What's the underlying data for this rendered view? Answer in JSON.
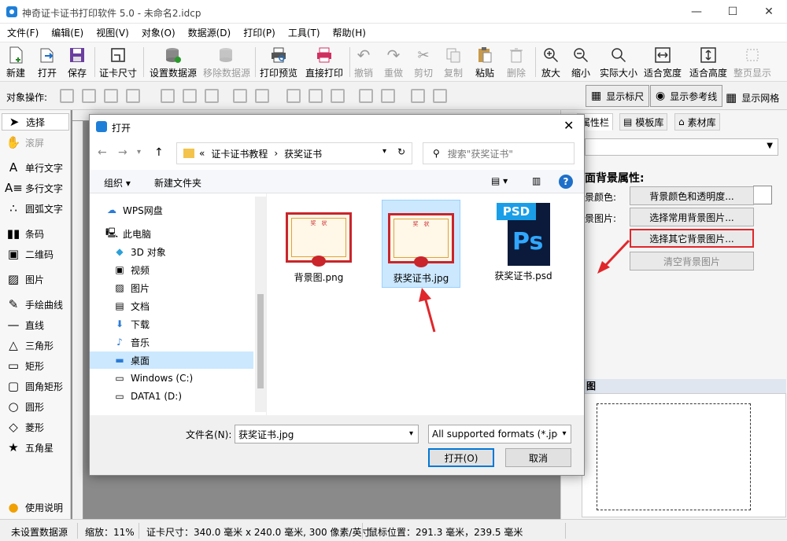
{
  "window": {
    "title": "神奇证卡证书打印软件 5.0 - 未命名2.idcp"
  },
  "menu": [
    "文件(F)",
    "编辑(E)",
    "视图(V)",
    "对象(O)",
    "数据源(D)",
    "打印(P)",
    "工具(T)",
    "帮助(H)"
  ],
  "toolbar": {
    "new": "新建",
    "open": "打开",
    "save": "保存",
    "card_size": "证卡尺寸",
    "set_datasource": "设置数据源",
    "remove_datasource": "移除数据源",
    "print_preview": "打印预览",
    "direct_print": "直接打印",
    "undo": "撤销",
    "redo": "重做",
    "cut": "剪切",
    "copy": "复制",
    "paste": "粘贴",
    "delete": "删除",
    "zoom_in": "放大",
    "zoom_out": "缩小",
    "actual_size": "实际大小",
    "fit_width": "适合宽度",
    "fit_height": "适合高度",
    "full_page": "整页显示"
  },
  "ops": {
    "label": "对象操作:",
    "show_ruler": "显示标尺",
    "show_guides": "显示参考线",
    "show_grid": "显示网格"
  },
  "tools": [
    "选择",
    "滚屏",
    "单行文字",
    "多行文字",
    "圆弧文字",
    "条码",
    "二维码",
    "图片",
    "手绘曲线",
    "直线",
    "三角形",
    "矩形",
    "圆角矩形",
    "圆形",
    "菱形",
    "五角星",
    "使用说明"
  ],
  "right_panel": {
    "tabs": [
      "属性栏",
      "模板库",
      "素材库"
    ],
    "section_title": "面背景属性:",
    "bg_color_label": "景颜色:",
    "bg_image_label": "景图片:",
    "btn_color": "背景颜色和透明度...",
    "btn_common_bg": "选择常用背景图片...",
    "btn_other_bg": "选择其它背景图片...",
    "btn_clear_bg": "清空背景图片",
    "preview_title": "图"
  },
  "status": {
    "datasource": "未设置数据源",
    "zoom": "缩放：11%",
    "card_size": "证卡尺寸：340.0 毫米 x 240.0 毫米, 300 像素/英寸",
    "mouse_pos": "鼠标位置：291.3 毫米，239.5 毫米"
  },
  "dialog": {
    "title": "打开",
    "breadcrumb": [
      "«",
      "证卡证书教程",
      "获奖证书"
    ],
    "search_placeholder": "搜索\"获奖证书\"",
    "organize": "组织 ▾",
    "new_folder": "新建文件夹",
    "nav_items": [
      "WPS网盘",
      "此电脑",
      "3D 对象",
      "视频",
      "图片",
      "文档",
      "下载",
      "音乐",
      "桌面",
      "Windows (C:)",
      "DATA1 (D:)"
    ],
    "files": [
      "背景图.png",
      "获奖证书.jpg",
      "获奖证书.psd"
    ],
    "thumb_text": "奖　状",
    "psd_badge": "PSD",
    "psd_logo": "Ps",
    "filename_label": "文件名(N):",
    "filename_value": "获奖证书.jpg",
    "filetype": "All supported formats (*.jpg, *.png, *.bmp)",
    "open_btn": "打开(O)",
    "cancel_btn": "取消"
  },
  "colors": {
    "accent_red": "#e0272b",
    "selection_blue": "#cce8ff",
    "brand_blue": "#1e7fd8"
  }
}
